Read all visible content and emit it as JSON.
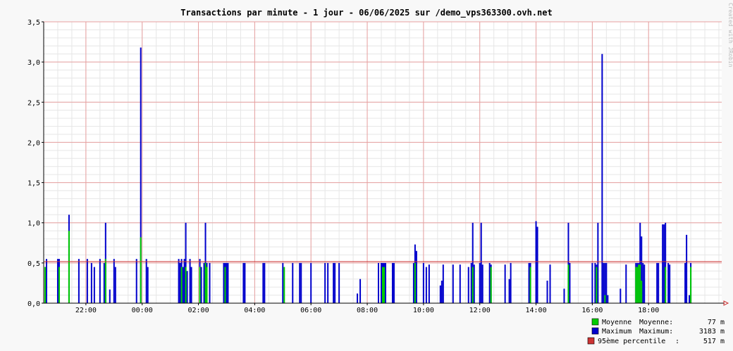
{
  "chart_data": {
    "type": "bar",
    "title": "Transactions par minute - 1 jour - 06/06/2025 sur /demo_vps363300.ovh.net",
    "watermark": "Created with JRobin",
    "ylim": [
      0,
      3.5
    ],
    "y_ticks": [
      0,
      0.5,
      1.0,
      1.5,
      2.0,
      2.5,
      3.0,
      3.5
    ],
    "y_tick_labels": [
      "0,0",
      "0,5",
      "1,0",
      "1,5",
      "2,0",
      "2,5",
      "3,0",
      "3,5"
    ],
    "x_range_hours": [
      20.5,
      44.6
    ],
    "x_ticks_hours": [
      22,
      24,
      26,
      28,
      30,
      32,
      34,
      36,
      38,
      40,
      42
    ],
    "x_tick_labels": [
      "22:00",
      "00:00",
      "02:00",
      "04:00",
      "06:00",
      "08:00",
      "10:00",
      "12:00",
      "14:00",
      "16:00",
      "18:00"
    ],
    "grid": true,
    "percentile_value": 0.517,
    "colors": {
      "average": "#00cc00",
      "maximum": "#0000cc",
      "percentile": "#cc3333",
      "grid_major": "#e8a0a0",
      "grid_minor": "#e6e6e6",
      "axis": "#000000"
    },
    "series_maximum": [
      [
        20.55,
        0.45
      ],
      [
        20.6,
        0.55
      ],
      [
        21.0,
        0.55
      ],
      [
        21.05,
        0.55
      ],
      [
        21.4,
        1.1
      ],
      [
        21.75,
        0.55
      ],
      [
        22.05,
        0.55
      ],
      [
        22.2,
        0.5
      ],
      [
        22.3,
        0.45
      ],
      [
        22.5,
        0.55
      ],
      [
        22.65,
        0.5
      ],
      [
        22.7,
        1.0
      ],
      [
        22.85,
        0.17
      ],
      [
        23.0,
        0.55
      ],
      [
        23.05,
        0.45
      ],
      [
        23.8,
        0.55
      ],
      [
        23.95,
        3.18
      ],
      [
        24.15,
        0.55
      ],
      [
        24.2,
        0.45
      ],
      [
        25.3,
        0.55
      ],
      [
        25.35,
        0.5
      ],
      [
        25.4,
        0.55
      ],
      [
        25.45,
        0.45
      ],
      [
        25.5,
        0.55
      ],
      [
        25.55,
        1.0
      ],
      [
        25.6,
        0.4
      ],
      [
        25.7,
        0.55
      ],
      [
        25.75,
        0.45
      ],
      [
        26.05,
        0.55
      ],
      [
        26.1,
        0.45
      ],
      [
        26.2,
        0.5
      ],
      [
        26.25,
        1.0
      ],
      [
        26.3,
        0.5
      ],
      [
        26.4,
        0.5
      ],
      [
        26.9,
        0.5
      ],
      [
        26.95,
        0.5
      ],
      [
        27.0,
        0.5
      ],
      [
        27.05,
        0.5
      ],
      [
        27.6,
        0.5
      ],
      [
        27.65,
        0.5
      ],
      [
        28.3,
        0.5
      ],
      [
        28.35,
        0.5
      ],
      [
        29.0,
        0.5
      ],
      [
        29.35,
        0.5
      ],
      [
        29.6,
        0.5
      ],
      [
        29.65,
        0.5
      ],
      [
        30.0,
        0.5
      ],
      [
        30.5,
        0.5
      ],
      [
        30.6,
        0.5
      ],
      [
        30.8,
        0.5
      ],
      [
        30.85,
        0.5
      ],
      [
        31.0,
        0.5
      ],
      [
        31.65,
        0.12
      ],
      [
        31.75,
        0.3
      ],
      [
        32.4,
        0.5
      ],
      [
        32.5,
        0.5
      ],
      [
        32.55,
        0.5
      ],
      [
        32.6,
        0.5
      ],
      [
        32.65,
        0.5
      ],
      [
        32.9,
        0.5
      ],
      [
        32.95,
        0.5
      ],
      [
        33.65,
        0.5
      ],
      [
        33.7,
        0.73
      ],
      [
        33.75,
        0.65
      ],
      [
        34.0,
        0.5
      ],
      [
        34.1,
        0.45
      ],
      [
        34.2,
        0.48
      ],
      [
        34.6,
        0.22
      ],
      [
        34.65,
        0.28
      ],
      [
        34.7,
        0.48
      ],
      [
        35.05,
        0.48
      ],
      [
        35.3,
        0.48
      ],
      [
        35.6,
        0.45
      ],
      [
        35.7,
        0.5
      ],
      [
        35.75,
        1.0
      ],
      [
        35.8,
        0.48
      ],
      [
        36.0,
        0.5
      ],
      [
        36.05,
        1.0
      ],
      [
        36.1,
        0.48
      ],
      [
        36.35,
        0.5
      ],
      [
        36.4,
        0.48
      ],
      [
        36.9,
        0.48
      ],
      [
        37.05,
        0.3
      ],
      [
        37.1,
        0.5
      ],
      [
        37.75,
        0.5
      ],
      [
        37.8,
        0.5
      ],
      [
        38.0,
        1.02
      ],
      [
        38.05,
        0.95
      ],
      [
        38.4,
        0.28
      ],
      [
        38.5,
        0.48
      ],
      [
        39.0,
        0.18
      ],
      [
        39.15,
        1.0
      ],
      [
        39.2,
        0.5
      ],
      [
        40.0,
        0.5
      ],
      [
        40.1,
        0.5
      ],
      [
        40.15,
        0.48
      ],
      [
        40.2,
        1.0
      ],
      [
        40.35,
        3.1
      ],
      [
        40.4,
        0.5
      ],
      [
        40.45,
        0.5
      ],
      [
        40.5,
        0.5
      ],
      [
        40.55,
        0.1
      ],
      [
        41.0,
        0.18
      ],
      [
        41.2,
        0.48
      ],
      [
        41.55,
        0.5
      ],
      [
        41.6,
        0.5
      ],
      [
        41.65,
        0.5
      ],
      [
        41.7,
        1.0
      ],
      [
        41.75,
        0.83
      ],
      [
        41.8,
        0.5
      ],
      [
        41.85,
        0.48
      ],
      [
        42.3,
        0.5
      ],
      [
        42.35,
        0.5
      ],
      [
        42.5,
        0.98
      ],
      [
        42.55,
        0.98
      ],
      [
        42.6,
        1.0
      ],
      [
        42.7,
        0.5
      ],
      [
        42.75,
        0.48
      ],
      [
        43.3,
        0.5
      ],
      [
        43.35,
        0.85
      ],
      [
        43.45,
        0.1
      ],
      [
        43.5,
        0.5
      ]
    ],
    "series_average": [
      [
        20.55,
        0.45
      ],
      [
        21.05,
        0.45
      ],
      [
        21.4,
        0.9
      ],
      [
        22.7,
        0.55
      ],
      [
        23.95,
        0.82
      ],
      [
        25.4,
        0.45
      ],
      [
        25.55,
        0.45
      ],
      [
        26.05,
        0.45
      ],
      [
        26.25,
        0.5
      ],
      [
        26.3,
        0.45
      ],
      [
        26.95,
        0.45
      ],
      [
        29.05,
        0.45
      ],
      [
        32.55,
        0.45
      ],
      [
        32.6,
        0.45
      ],
      [
        33.7,
        0.5
      ],
      [
        35.75,
        0.45
      ],
      [
        36.4,
        0.45
      ],
      [
        37.8,
        0.45
      ],
      [
        39.15,
        0.48
      ],
      [
        40.15,
        0.45
      ],
      [
        40.45,
        0.1
      ],
      [
        41.55,
        0.45
      ],
      [
        41.6,
        0.45
      ],
      [
        41.65,
        0.48
      ],
      [
        41.7,
        0.48
      ],
      [
        41.75,
        0.28
      ],
      [
        42.6,
        0.45
      ],
      [
        43.5,
        0.45
      ]
    ],
    "legend": [
      {
        "swatch": "average",
        "label": "Moyenne",
        "stat_label": "Moyenne:",
        "value": "77 m"
      },
      {
        "swatch": "maximum",
        "label": "Maximum",
        "stat_label": "Maximum:",
        "value": "3183 m"
      },
      {
        "swatch": "percentile",
        "label": "95ème percentile",
        "stat_label": ":",
        "value": "517 m"
      }
    ]
  }
}
